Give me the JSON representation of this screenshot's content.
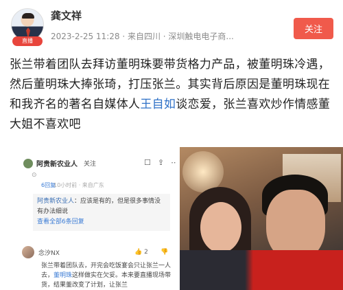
{
  "post": {
    "username": "龚文祥",
    "live_badge": "直播",
    "meta": "2023-2-25 11:28 · 来自四川 · 深圳触电电子商...",
    "follow_label": "关注",
    "text_before": "张兰带着团队去拜访董明珠要带货格力产品，被董明珠冷遇，然后董明珠大捧张琦，打压张兰。其实背后原因是董明珠现在和我齐名的著名自媒体人",
    "mention": "王自如",
    "text_after": "谈恋爱，张兰喜欢炒作情感董大姐不喜欢吧"
  },
  "embed": {
    "username": "阿贵新农业人",
    "follow": "关注",
    "icons": [
      "comment-icon",
      "share-icon",
      "more-icon"
    ],
    "sub": "⊙",
    "reply_count": "6回复",
    "meta": "10小时前 · 来自广东",
    "quote_user": "阿贵新农业人",
    "quote_text": "：应该是有的，但是很多事情没有办法细说",
    "quote_more": "查看全部6条回复",
    "comment_user": "念汐NX",
    "like_count": "2",
    "comment_before": "张兰带着团队去，开完会吃饭宴会只让张兰一人去，",
    "comment_mention": "董明珠",
    "comment_after": "这样做实在欠妥。本来要直播现场带货，结果董改变了计划，让张兰"
  },
  "colors": {
    "follow_button": "#f05a4b",
    "mention": "#2f71c7",
    "live_badge": "#e8453c"
  }
}
